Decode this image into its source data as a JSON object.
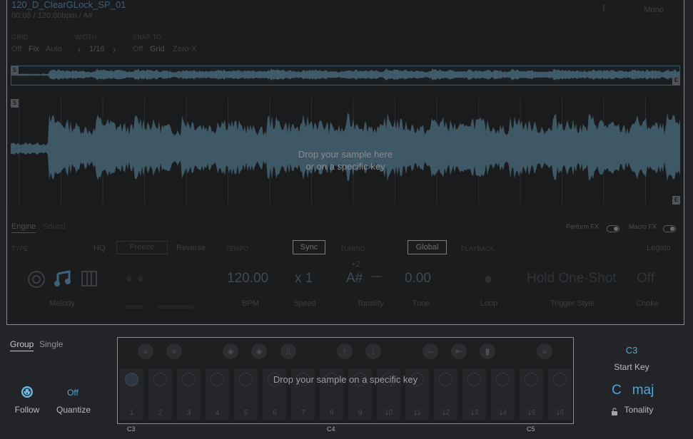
{
  "editor": {
    "file_name": "120_D_ClearGLock_SP_01",
    "file_meta": "00:08 / 120.00bpm / A#",
    "mono_label": "Mono",
    "grid": {
      "label": "GRID",
      "options": [
        "Off",
        "Fix",
        "Auto"
      ]
    },
    "width": {
      "label": "WIDTH",
      "prev": "‹",
      "value": "1/16",
      "next": "›"
    },
    "snap": {
      "label": "SNAP TO",
      "options": [
        "Off",
        "Grid",
        "Zero-X"
      ]
    },
    "start_marker": "S",
    "end_marker": "E",
    "drop_line1": "Drop your sample here",
    "drop_line2": "or on a specific key",
    "tabs": [
      "Engine",
      "Sound"
    ],
    "perform_fx_label": "Perform FX",
    "macro_fx_label": "Macro FX",
    "type_label": "TYPE",
    "hq_label": "HQ",
    "freeze_label": "Freeze",
    "reverse_label": "Reverse",
    "tempo_label": "TEMPO",
    "sync_label": "Sync",
    "tuning_label": "TUNING",
    "global_label": "Global",
    "playback_label": "PLAYBACK",
    "legato_label": "Legato",
    "bpm_value": "120.00",
    "speed_value": "x 1",
    "tonality_offset": "+2",
    "tonality_value": "A#",
    "tonality_dash": "—",
    "tune_value": "0.00",
    "trigger_value": "Hold One-Shot",
    "choke_value": "Off",
    "captions": {
      "melody": "Melody",
      "bpm": "BPM",
      "speed": "Speed",
      "tonality": "Tonality",
      "tune": "Tune",
      "loop": "Loop",
      "trigger": "Trigger Style",
      "choke": "Choke"
    }
  },
  "bottom": {
    "modes": [
      "Group",
      "Single"
    ],
    "follow_label": "Follow",
    "quantize_value": "Off",
    "quantize_label": "Quantize",
    "drop_text": "Drop your sample on a specific key",
    "key_numbers": [
      "1",
      "2",
      "3",
      "4",
      "5",
      "6",
      "7",
      "8",
      "9",
      "10",
      "11",
      "12",
      "13",
      "14",
      "15",
      "16"
    ],
    "octave_labels": [
      "C3",
      "C4",
      "C5"
    ],
    "start_key_value": "C3",
    "start_key_label": "Start Key",
    "tonality_root": "C",
    "tonality_scale": "maj",
    "tonality_label": "Tonality"
  }
}
